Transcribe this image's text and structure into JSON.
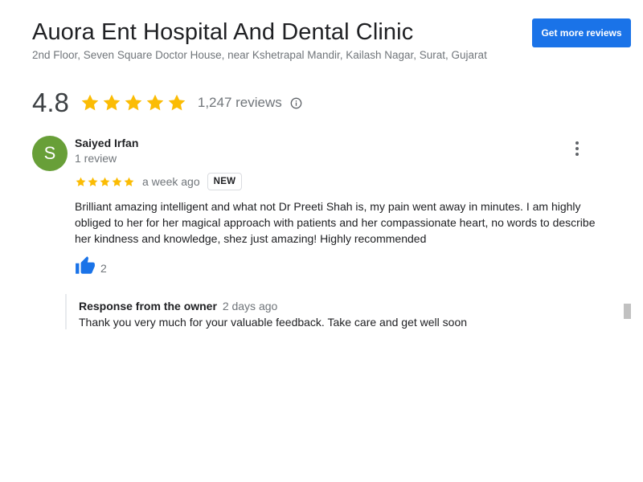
{
  "header": {
    "title": "Auora Ent Hospital And Dental Clinic",
    "address": "2nd Floor, Seven Square Doctor House, near Kshetrapal Mandir, Kailash Nagar, Surat, Gujarat",
    "get_more_label": "Get more reviews"
  },
  "summary": {
    "rating": "4.8",
    "stars": 5,
    "review_count": "1,247 reviews",
    "star_color": "#fbbc04"
  },
  "review": {
    "avatar_letter": "S",
    "avatar_color": "#689f38",
    "name": "Saiyed Irfan",
    "review_count": "1 review",
    "stars": 5,
    "time": "a week ago",
    "badge": "NEW",
    "text": "Brilliant amazing intelligent and what not Dr Preeti Shah is, my pain went away in minutes. I am highly obliged to her for her magical approach with patients and her compassionate heart, no words to describe her kindness and knowledge, shez just amazing! Highly recommended",
    "likes": "2",
    "like_icon_color": "#1a73e8"
  },
  "owner_response": {
    "label": "Response from the owner",
    "time": "2 days ago",
    "text": "Thank you very much for your valuable feedback. Take care and get well soon"
  },
  "colors": {
    "accent": "#1a73e8",
    "secondary_text": "#70757a"
  }
}
